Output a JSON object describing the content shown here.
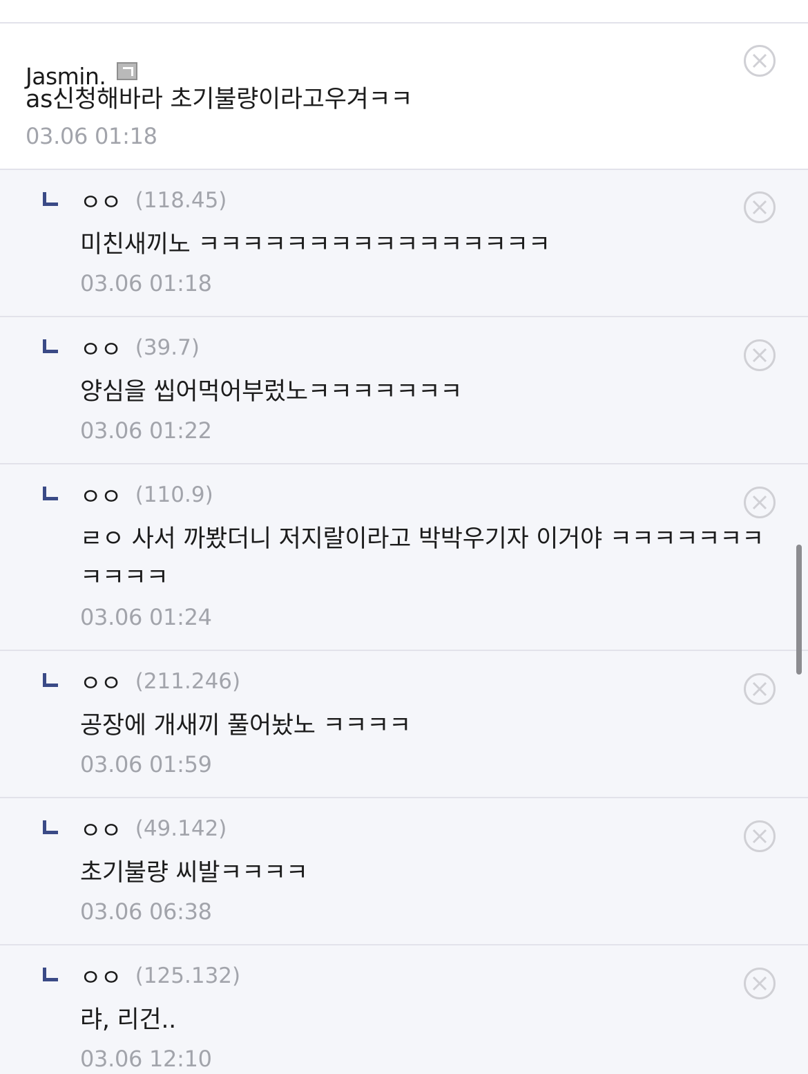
{
  "comments": [
    {
      "type": "main",
      "nickname": "Jasmin.",
      "ip": "",
      "text": "as신청해바라 초기불량이라고우겨ㅋㅋ",
      "time": "03.06 01:18"
    },
    {
      "type": "reply",
      "nickname": "ㅇㅇ",
      "ip": "(118.45)",
      "text": "미친새끼노 ㅋㅋㅋㅋㅋㅋㅋㅋㅋㅋㅋㅋㅋㅋㅋㅋ",
      "time": "03.06 01:18"
    },
    {
      "type": "reply",
      "nickname": "ㅇㅇ",
      "ip": "(39.7)",
      "text": "양심을 씹어먹어부렀노ㅋㅋㅋㅋㅋㅋㅋ",
      "time": "03.06 01:22"
    },
    {
      "type": "reply",
      "nickname": "ㅇㅇ",
      "ip": "(110.9)",
      "text": "ㄹㅇ 사서 까봤더니 저지랄이라고 박박우기자 이거야 ㅋㅋㅋㅋㅋㅋㅋㅋㅋㅋㅋ",
      "time": "03.06 01:24"
    },
    {
      "type": "reply",
      "nickname": "ㅇㅇ",
      "ip": "(211.246)",
      "text": "공장에 개새끼 풀어놨노 ㅋㅋㅋㅋ",
      "time": "03.06 01:59"
    },
    {
      "type": "reply",
      "nickname": "ㅇㅇ",
      "ip": "(49.142)",
      "text": "초기불량 씨발ㅋㅋㅋㅋ",
      "time": "03.06 06:38"
    },
    {
      "type": "reply",
      "nickname": "ㅇㅇ",
      "ip": "(125.132)",
      "text": "랴, 리건..",
      "time": "03.06 12:10"
    }
  ],
  "icons": {
    "delete": "close-circle-icon",
    "reply": "reply-arrow-icon",
    "member": "gallery-member-icon"
  },
  "colors": {
    "reply_background": "#f5f6fa",
    "reply_arrow": "#3a4a86",
    "meta_text": "#a2a4ab"
  }
}
